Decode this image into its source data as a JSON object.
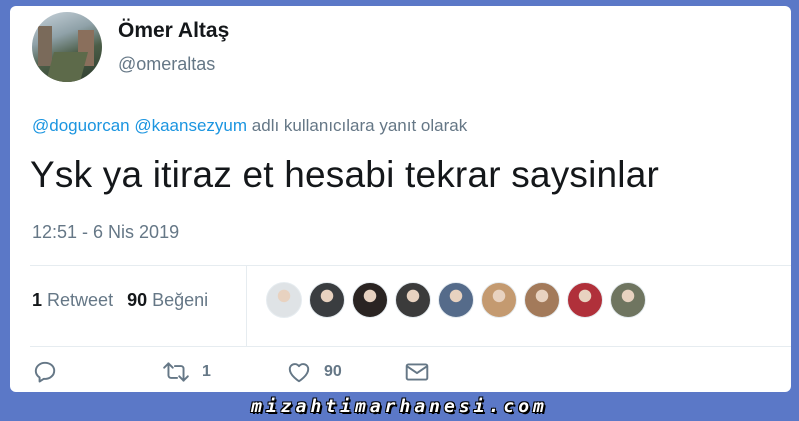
{
  "tweet": {
    "author_name": "Ömer Altaş",
    "author_handle": "@omeraltas",
    "reply_mention_1": "@doguorcan",
    "reply_mention_2": "@kaansezyum",
    "reply_suffix": "adlı kullanıcılara yanıt olarak",
    "text": "Ysk ya itiraz et hesabi tekrar saysinlar",
    "timestamp": "12:51 - 6 Nis 2019"
  },
  "stats": {
    "retweet_count": "1",
    "retweet_label": "Retweet",
    "like_count": "90",
    "like_label": "Beğeni"
  },
  "likers": [
    {
      "name": "liker-avatar-1",
      "color": "#dfe3e6"
    },
    {
      "name": "liker-avatar-2",
      "color": "#3a3d40"
    },
    {
      "name": "liker-avatar-3",
      "color": "#2a2422"
    },
    {
      "name": "liker-avatar-4",
      "color": "#3b3b3b"
    },
    {
      "name": "liker-avatar-5",
      "color": "#556b8a"
    },
    {
      "name": "liker-avatar-6",
      "color": "#c49a70"
    },
    {
      "name": "liker-avatar-7",
      "color": "#a37a5a"
    },
    {
      "name": "liker-avatar-8",
      "color": "#b0303a"
    },
    {
      "name": "liker-avatar-9",
      "color": "#6f7560"
    }
  ],
  "actions": {
    "reply_icon": "reply-icon",
    "retweet_icon": "retweet-icon",
    "retweet_count": "1",
    "like_icon": "heart-icon",
    "like_count": "90",
    "message_icon": "envelope-icon"
  },
  "watermark": "mizahtimarhanesi.com",
  "colors": {
    "background": "#5b78c7",
    "link": "#1b95e0",
    "secondary_text": "#657786",
    "primary_text": "#14171a"
  }
}
